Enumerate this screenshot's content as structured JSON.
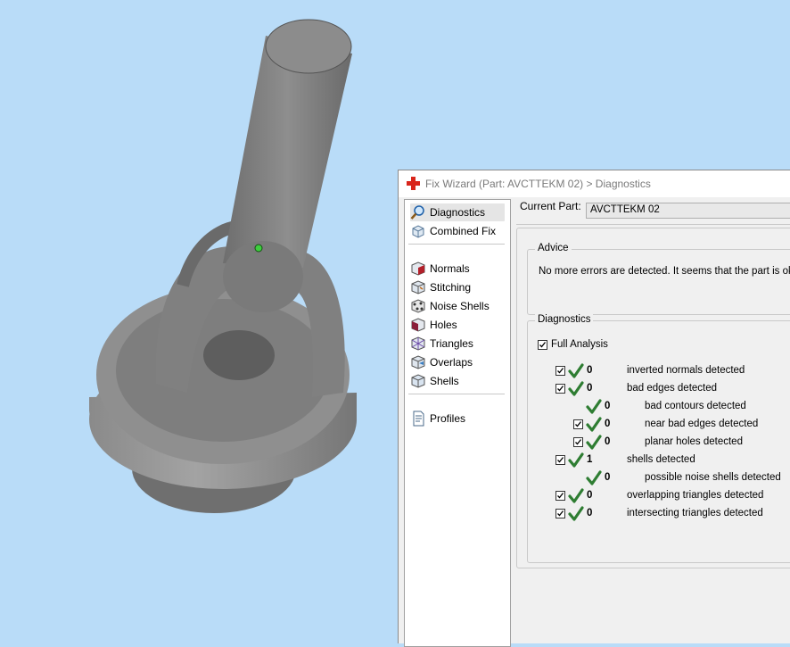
{
  "dialog": {
    "title": "Fix Wizard (Part: AVCTTEKM 02) > Diagnostics"
  },
  "nav": {
    "items": [
      {
        "label": "Diagnostics",
        "icon": "magnifier-icon",
        "selected": true
      },
      {
        "label": "Combined Fix",
        "icon": "combined-fix-icon"
      },
      {
        "label": "Normals",
        "icon": "normals-cube-icon"
      },
      {
        "label": "Stitching",
        "icon": "stitching-cube-icon"
      },
      {
        "label": "Noise Shells",
        "icon": "noise-shells-icon"
      },
      {
        "label": "Holes",
        "icon": "holes-cube-icon"
      },
      {
        "label": "Triangles",
        "icon": "triangles-cube-icon"
      },
      {
        "label": "Overlaps",
        "icon": "overlaps-cube-icon"
      },
      {
        "label": "Shells",
        "icon": "shells-cube-icon"
      },
      {
        "label": "Profiles",
        "icon": "profiles-document-icon"
      }
    ]
  },
  "current_part": {
    "label": "Current Part:",
    "value": "AVCTTEKM 02"
  },
  "advice": {
    "title": "Advice",
    "text": "No more errors are detected. It seems that the part is ok"
  },
  "diagnostics": {
    "title": "Diagnostics",
    "full_analysis_label": "Full Analysis",
    "full_analysis_checked": true,
    "rows": [
      {
        "count": "0",
        "text": "inverted normals detected",
        "checkbox": true,
        "indent": 0
      },
      {
        "count": "0",
        "text": "bad edges detected",
        "checkbox": true,
        "indent": 0
      },
      {
        "count": "0",
        "text": "bad contours detected",
        "checkbox": false,
        "indent": 1
      },
      {
        "count": "0",
        "text": "near bad edges detected",
        "checkbox": true,
        "indent": 1
      },
      {
        "count": "0",
        "text": "planar holes detected",
        "checkbox": true,
        "indent": 1
      },
      {
        "count": "1",
        "text": "shells detected",
        "checkbox": true,
        "indent": 0
      },
      {
        "count": "0",
        "text": "possible noise shells detected",
        "checkbox": false,
        "indent": 1
      },
      {
        "count": "0",
        "text": "overlapping triangles detected",
        "checkbox": true,
        "indent": 0
      },
      {
        "count": "0",
        "text": "intersecting triangles detected",
        "checkbox": true,
        "indent": 0
      }
    ]
  },
  "colors": {
    "viewport_bg": "#b9dcf8",
    "check_green": "#2e7d32",
    "part_gray": "#7a7a7a"
  }
}
